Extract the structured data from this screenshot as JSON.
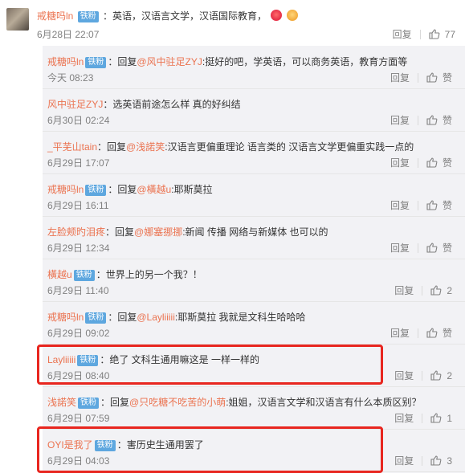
{
  "main": {
    "user": "戒糖吗ln",
    "badge": "铁粉",
    "text": "：英语，汉语言文学，汉语国际教育，",
    "time": "6月28日 22:07",
    "reply": "回复",
    "likes": "77"
  },
  "replies": [
    {
      "user": "戒糖吗ln",
      "badge": "铁粉",
      "prefix": "：回复",
      "mention": "@风中驻足ZYJ",
      "text": ":挺好的吧，学英语，可以商务英语，教育方面等",
      "time": "今天 08:23",
      "reply": "回复",
      "likes": "赞"
    },
    {
      "user": "风中驻足ZYJ",
      "badge": "",
      "prefix": "",
      "mention": "",
      "text": "：选英语前途怎么样 真的好纠结",
      "time": "6月30日 02:24",
      "reply": "回复",
      "likes": "赞"
    },
    {
      "user": "_平芜山tain",
      "badge": "",
      "prefix": "：回复",
      "mention": "@浅諾笑",
      "text": ":汉语言更偏重理论 语言类的 汉语言文学更偏重实践一点的",
      "time": "6月29日 17:07",
      "reply": "回复",
      "likes": "赞"
    },
    {
      "user": "戒糖吗ln",
      "badge": "铁粉",
      "prefix": "：回复",
      "mention": "@橫越u",
      "text": ":耶斯莫拉",
      "time": "6月29日 16:11",
      "reply": "回复",
      "likes": "赞"
    },
    {
      "user": "左脸颊旳泪疼",
      "badge": "",
      "prefix": "：回复",
      "mention": "@娜塞挪挪",
      "text": ":新闻 传播 网络与新媒体 也可以的",
      "time": "6月29日 12:34",
      "reply": "回复",
      "likes": "赞"
    },
    {
      "user": "橫越u",
      "badge": "铁粉",
      "prefix": "",
      "mention": "",
      "text": "：世界上的另一个我？！",
      "time": "6月29日 11:40",
      "reply": "回复",
      "likes": "2"
    },
    {
      "user": "戒糖吗ln",
      "badge": "铁粉",
      "prefix": "：回复",
      "mention": "@Layliiiii",
      "text": ":耶斯莫拉 我就是文科生哈哈哈",
      "time": "6月29日 09:02",
      "reply": "回复",
      "likes": "赞"
    },
    {
      "user": "Layliiiii",
      "badge": "铁粉",
      "prefix": "",
      "mention": "",
      "text": "：绝了  文科生通用嘛这是   一样一样的",
      "time": "6月29日 08:40",
      "reply": "回复",
      "likes": "2"
    },
    {
      "user": "浅諾笑",
      "badge": "铁粉",
      "prefix": "：回复",
      "mention": "@只吃糖不吃苦的小萌",
      "text": ":姐姐，汉语言文学和汉语言有什么本质区别？",
      "time": "6月29日 07:59",
      "reply": "回复",
      "likes": "1"
    },
    {
      "user": "OYI是我了",
      "badge": "铁粉",
      "prefix": "",
      "mention": "",
      "text": "：害历史生通用罢了",
      "time": "6月29日 04:03",
      "reply": "回复",
      "likes": "3"
    }
  ],
  "colors": {
    "username": "#eb7350",
    "badge": "#5ea7df",
    "highlight": "#e8261f",
    "replies_bg": "#f2f2f5"
  }
}
